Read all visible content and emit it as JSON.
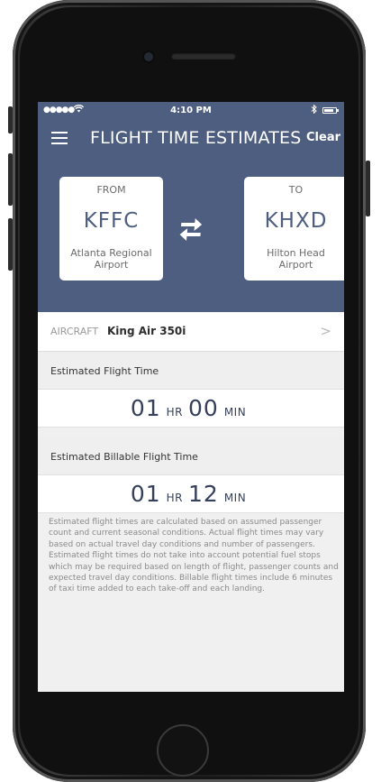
{
  "status_bar": {
    "signal": "●●●●●",
    "time": "4:10 PM"
  },
  "header": {
    "title": "FLIGHT TIME ESTIMATES",
    "clear_label": "Clear",
    "menu_icon": "hamburger-menu-icon",
    "swap_icon": "swap-arrows-icon"
  },
  "route": {
    "from": {
      "label": "FROM",
      "code": "KFFC",
      "name_line1": "Atlanta Regional",
      "name_line2": "Airport"
    },
    "to": {
      "label": "TO",
      "code": "KHXD",
      "name_line1": "Hilton Head",
      "name_line2": "Airport"
    }
  },
  "aircraft": {
    "key": "AIRCRAFT",
    "value": "King Air 350i",
    "chevron": ">"
  },
  "estimated": {
    "label": "Estimated Flight Time",
    "hours": "01",
    "hr_unit": "HR",
    "minutes": "00",
    "min_unit": "MIN"
  },
  "billable": {
    "label": "Estimated Billable Flight Time",
    "hours": "01",
    "hr_unit": "HR",
    "minutes": "12",
    "min_unit": "MIN"
  },
  "disclaimer": "Estimated flight times are calculated based on assumed passenger count and current seasonal conditions. Actual flight times may vary based on actual travel day conditions and number of passengers. Estimated flight times do not take into account potential fuel stops which may be required based on length of flight, passenger counts and  expected travel day conditions. Billable flight times include 6 minutes of taxi time added to each take-off and each landing.",
  "colors": {
    "header_bg": "#4d5e80",
    "screen_bg": "#f0f0f0",
    "time_text": "#36405a"
  }
}
